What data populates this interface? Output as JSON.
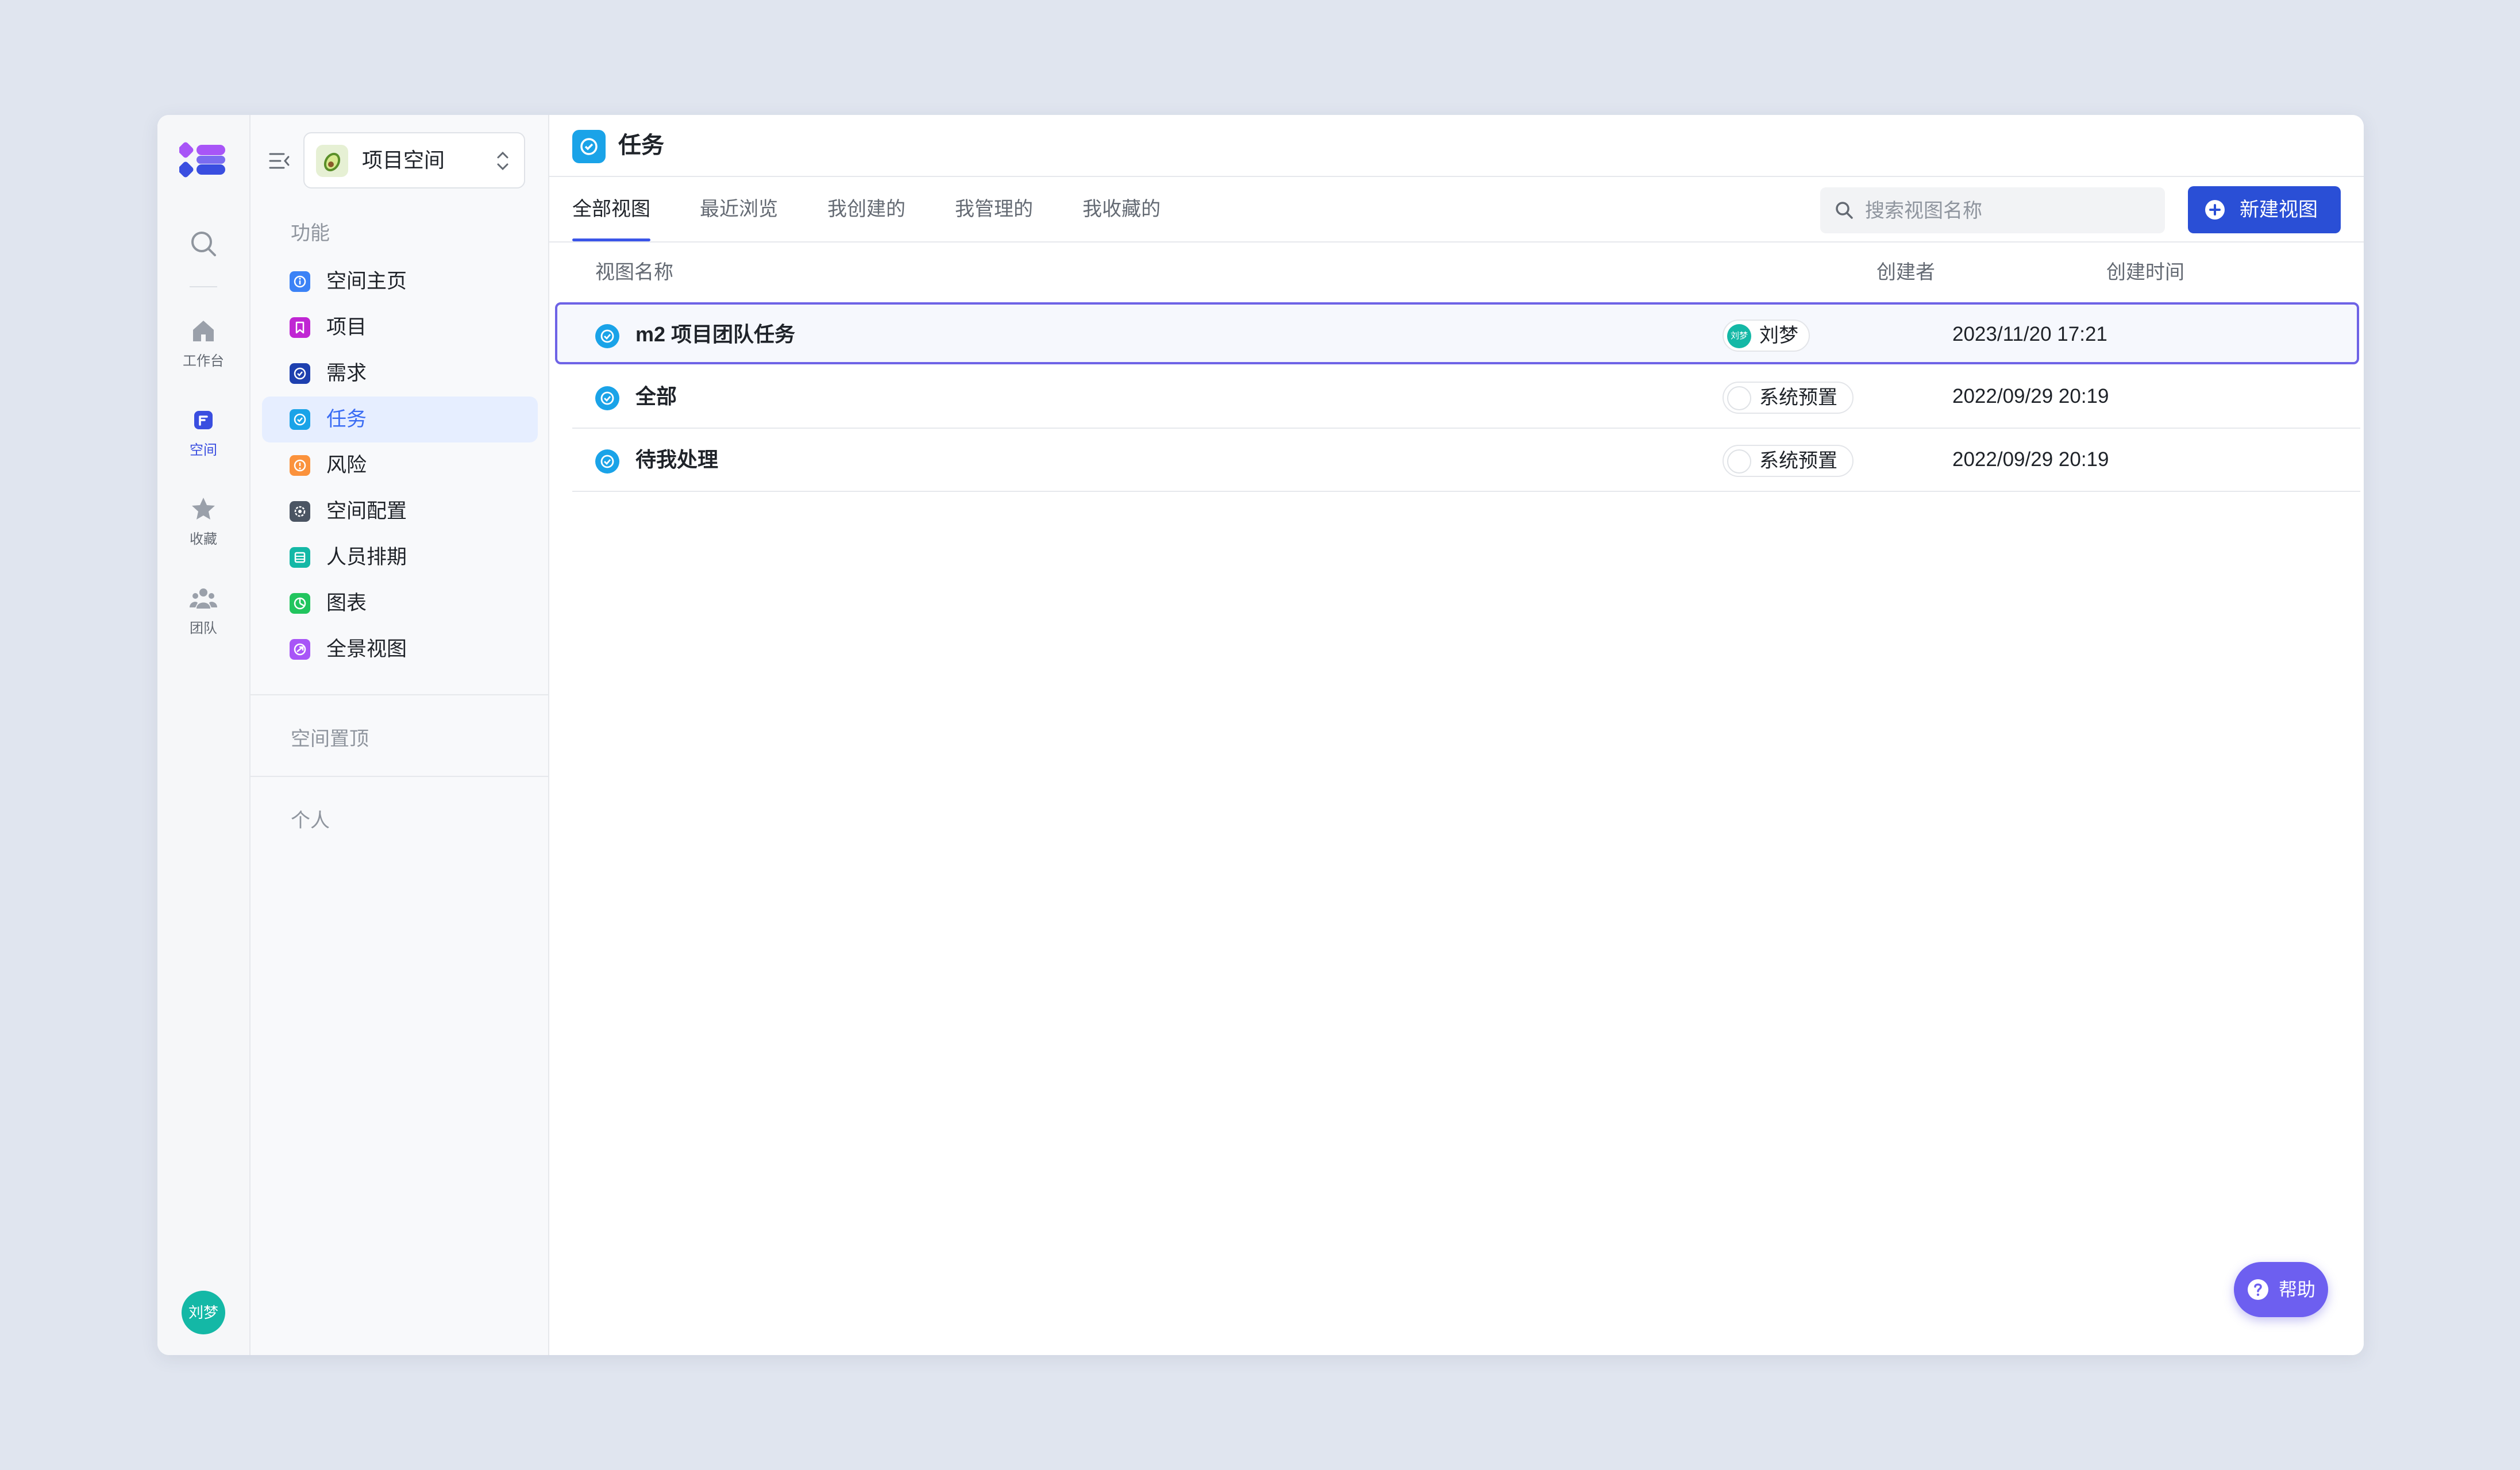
{
  "rail": {
    "items": [
      {
        "label": "工作台"
      },
      {
        "label": "空间"
      },
      {
        "label": "收藏"
      },
      {
        "label": "团队"
      }
    ],
    "user_avatar_text": "刘梦"
  },
  "sidebar": {
    "space_name": "项目空间",
    "section_features": "功能",
    "items": [
      {
        "label": "空间主页",
        "icon": "info-icon",
        "color": "#3b82f6"
      },
      {
        "label": "项目",
        "icon": "bookmark-icon",
        "color": "#c026d3"
      },
      {
        "label": "需求",
        "icon": "check-circle-icon",
        "color": "#1e40af"
      },
      {
        "label": "任务",
        "icon": "check-circle-icon",
        "color": "#1aa3e8"
      },
      {
        "label": "风险",
        "icon": "warning-icon",
        "color": "#fb923c"
      },
      {
        "label": "空间配置",
        "icon": "gear-icon",
        "color": "#4b5563"
      },
      {
        "label": "人员排期",
        "icon": "calendar-icon",
        "color": "#14b8a6"
      },
      {
        "label": "图表",
        "icon": "chart-icon",
        "color": "#22c55e"
      },
      {
        "label": "全景视图",
        "icon": "panorama-icon",
        "color": "#a855f7"
      }
    ],
    "section_pinned": "空间置顶",
    "section_personal": "个人"
  },
  "main": {
    "title": "任务",
    "tabs": [
      {
        "label": "全部视图",
        "active": true
      },
      {
        "label": "最近浏览"
      },
      {
        "label": "我创建的"
      },
      {
        "label": "我管理的"
      },
      {
        "label": "我收藏的"
      }
    ],
    "search_placeholder": "搜索视图名称",
    "new_view_label": "新建视图",
    "columns": {
      "name": "视图名称",
      "creator": "创建者",
      "created": "创建时间"
    },
    "rows": [
      {
        "name": "m2 项目团队任务",
        "creator": "刘梦",
        "creator_avatar_text": "刘梦",
        "created": "2023/11/20 17:21",
        "selected": true
      },
      {
        "name": "全部",
        "creator": "系统预置",
        "created": "2022/09/29 20:19"
      },
      {
        "name": "待我处理",
        "creator": "系统预置",
        "created": "2022/09/29 20:19"
      }
    ],
    "help_label": "帮助"
  },
  "colors": {
    "accent": "#2a4fd6",
    "selection_border": "#6e63e6",
    "task_blue": "#1aa3e8",
    "help_purple": "#6d5ff0"
  }
}
